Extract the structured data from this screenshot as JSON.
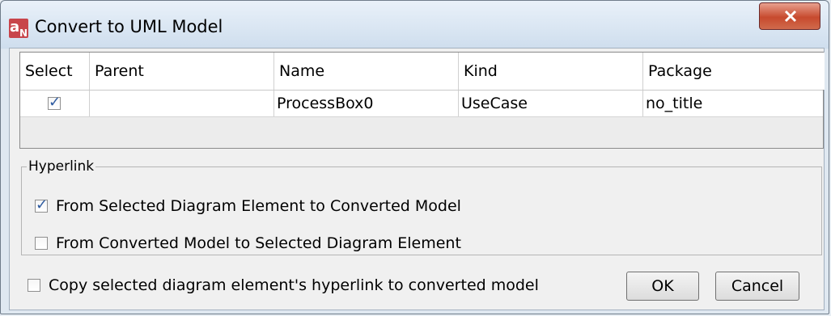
{
  "window": {
    "title": "Convert to UML Model"
  },
  "table": {
    "columns": [
      "Select",
      "Parent",
      "Name",
      "Kind",
      "Package"
    ],
    "rows": [
      {
        "select": true,
        "parent": "",
        "name": "ProcessBox0",
        "kind": "UseCase",
        "package": "no_title"
      }
    ]
  },
  "hyperlink": {
    "legend": "Hyperlink",
    "options": [
      {
        "label": "From Selected Diagram Element to Converted Model",
        "checked": true
      },
      {
        "label": "From Converted Model to Selected Diagram Element",
        "checked": false
      }
    ]
  },
  "copy_option": {
    "label": "Copy selected diagram element's hyperlink to converted model",
    "checked": false
  },
  "buttons": {
    "ok": "OK",
    "cancel": "Cancel"
  },
  "colors": {
    "close_button": "#c74a2e",
    "checkmark": "#2d5aa0"
  }
}
